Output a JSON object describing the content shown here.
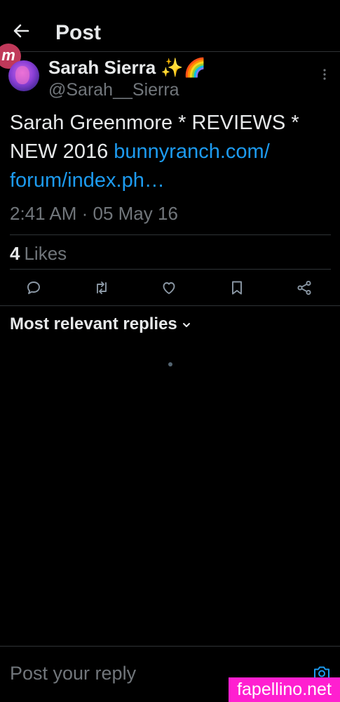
{
  "header": {
    "title": "Post"
  },
  "watermark_logo": "m",
  "author": {
    "name": "Sarah Sierra ✨🌈",
    "handle": "@Sarah__Sierra"
  },
  "tweet": {
    "text": "Sarah Greenmore * REVIEWS * NEW 2016 ",
    "link": "bunnyranch.com/ forum/index.ph…",
    "timestamp": "2:41 AM · 05 May 16"
  },
  "stats": {
    "likes_count": "4",
    "likes_label": "Likes"
  },
  "actions": [
    {
      "name": "reply",
      "icon": "reply-icon"
    },
    {
      "name": "repost",
      "icon": "repost-icon"
    },
    {
      "name": "like",
      "icon": "heart-icon"
    },
    {
      "name": "bookmark",
      "icon": "bookmark-icon"
    },
    {
      "name": "share",
      "icon": "share-icon"
    }
  ],
  "replies": {
    "sort_label": "Most relevant replies"
  },
  "composer": {
    "placeholder": "Post your reply"
  },
  "site_watermark": "fapellino.net",
  "colors": {
    "background": "#000000",
    "text": "#e7e9ea",
    "muted": "#71767b",
    "link": "#1d9bf0",
    "divider": "#2f3336",
    "watermark": "#ff1fd0"
  }
}
